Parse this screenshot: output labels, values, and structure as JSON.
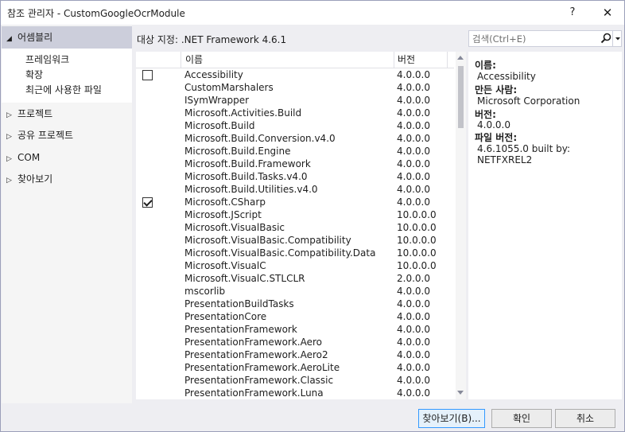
{
  "window": {
    "title": "참조 관리자 - CustomGoogleOcrModule",
    "help_label": "?",
    "close_label": "✕"
  },
  "sidebar": {
    "assemblies": {
      "label": "어셈블리",
      "expanded": true,
      "children": [
        "프레임워크",
        "확장",
        "최근에 사용한 파일"
      ]
    },
    "projects": {
      "label": "프로젝트"
    },
    "shared": {
      "label": "공유 프로젝트"
    },
    "com": {
      "label": "COM"
    },
    "browse": {
      "label": "찾아보기"
    }
  },
  "target": {
    "label": "대상 지정: .NET Framework 4.6.1"
  },
  "search": {
    "placeholder": "검색(Ctrl+E)"
  },
  "list": {
    "columns": {
      "name": "이름",
      "version": "버전"
    },
    "rows": [
      {
        "name": "Accessibility",
        "version": "4.0.0.0",
        "checkbox": "unchecked"
      },
      {
        "name": "CustomMarshalers",
        "version": "4.0.0.0"
      },
      {
        "name": "ISymWrapper",
        "version": "4.0.0.0"
      },
      {
        "name": "Microsoft.Activities.Build",
        "version": "4.0.0.0"
      },
      {
        "name": "Microsoft.Build",
        "version": "4.0.0.0"
      },
      {
        "name": "Microsoft.Build.Conversion.v4.0",
        "version": "4.0.0.0"
      },
      {
        "name": "Microsoft.Build.Engine",
        "version": "4.0.0.0"
      },
      {
        "name": "Microsoft.Build.Framework",
        "version": "4.0.0.0"
      },
      {
        "name": "Microsoft.Build.Tasks.v4.0",
        "version": "4.0.0.0"
      },
      {
        "name": "Microsoft.Build.Utilities.v4.0",
        "version": "4.0.0.0"
      },
      {
        "name": "Microsoft.CSharp",
        "version": "4.0.0.0",
        "checkbox": "checked"
      },
      {
        "name": "Microsoft.JScript",
        "version": "10.0.0.0"
      },
      {
        "name": "Microsoft.VisualBasic",
        "version": "10.0.0.0"
      },
      {
        "name": "Microsoft.VisualBasic.Compatibility",
        "version": "10.0.0.0"
      },
      {
        "name": "Microsoft.VisualBasic.Compatibility.Data",
        "version": "10.0.0.0"
      },
      {
        "name": "Microsoft.VisualC",
        "version": "10.0.0.0"
      },
      {
        "name": "Microsoft.VisualC.STLCLR",
        "version": "2.0.0.0"
      },
      {
        "name": "mscorlib",
        "version": "4.0.0.0"
      },
      {
        "name": "PresentationBuildTasks",
        "version": "4.0.0.0"
      },
      {
        "name": "PresentationCore",
        "version": "4.0.0.0"
      },
      {
        "name": "PresentationFramework",
        "version": "4.0.0.0"
      },
      {
        "name": "PresentationFramework.Aero",
        "version": "4.0.0.0"
      },
      {
        "name": "PresentationFramework.Aero2",
        "version": "4.0.0.0"
      },
      {
        "name": "PresentationFramework.AeroLite",
        "version": "4.0.0.0"
      },
      {
        "name": "PresentationFramework.Classic",
        "version": "4.0.0.0"
      },
      {
        "name": "PresentationFramework.Luna",
        "version": "4.0.0.0"
      }
    ]
  },
  "details": {
    "name_label": "이름:",
    "name_value": "Accessibility",
    "author_label": "만든 사람:",
    "author_value": "Microsoft Corporation",
    "version_label": "버전:",
    "version_value": "4.0.0.0",
    "file_version_label": "파일 버전:",
    "file_version_value": "4.6.1055.0 built by: NETFXREL2"
  },
  "buttons": {
    "browse": "찾아보기(B)...",
    "ok": "확인",
    "cancel": "취소"
  },
  "icons": {
    "search": "search-icon",
    "dropdown": "chevron-down-icon",
    "expand": "chevron-right-icon",
    "collapse": "chevron-down-icon"
  },
  "colors": {
    "accent": "#3399ff",
    "selection": "#cccedb",
    "background": "#eeeef2"
  }
}
